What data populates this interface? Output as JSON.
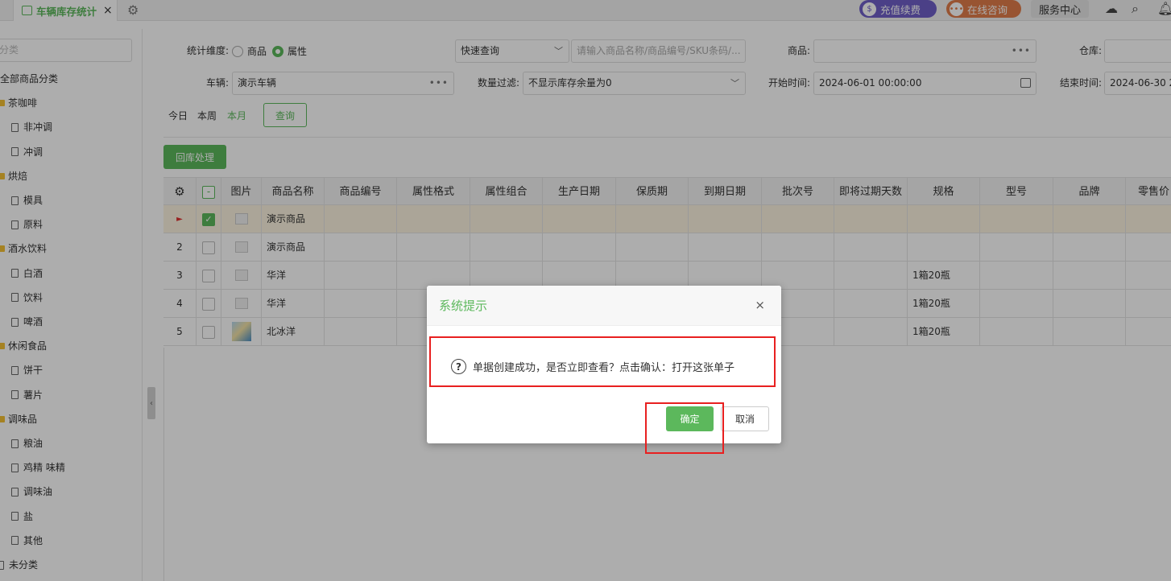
{
  "tabs": {
    "active_label": "车辆库存统计",
    "close_label": "×"
  },
  "header": {
    "recharge": "充值续费",
    "consult": "在线咨询",
    "service": "服务中心"
  },
  "sidebar": {
    "search_placeholder": "分类",
    "items": [
      {
        "label": "全部商品分类",
        "kind": "root"
      },
      {
        "label": "茶咖啡",
        "kind": "folder"
      },
      {
        "label": "非冲调",
        "kind": "file"
      },
      {
        "label": "冲调",
        "kind": "file"
      },
      {
        "label": "烘焙",
        "kind": "folder"
      },
      {
        "label": "模具",
        "kind": "file"
      },
      {
        "label": "原料",
        "kind": "file"
      },
      {
        "label": "酒水饮料",
        "kind": "folder"
      },
      {
        "label": "白酒",
        "kind": "file"
      },
      {
        "label": "饮料",
        "kind": "file"
      },
      {
        "label": "啤酒",
        "kind": "file"
      },
      {
        "label": "休闲食品",
        "kind": "folder"
      },
      {
        "label": "饼干",
        "kind": "file"
      },
      {
        "label": "薯片",
        "kind": "file"
      },
      {
        "label": "调味品",
        "kind": "folder"
      },
      {
        "label": "粮油",
        "kind": "file"
      },
      {
        "label": "鸡精 味精",
        "kind": "file"
      },
      {
        "label": "调味油",
        "kind": "file"
      },
      {
        "label": "盐",
        "kind": "file"
      },
      {
        "label": "其他",
        "kind": "file"
      },
      {
        "label": "未分类",
        "kind": "root-file"
      }
    ]
  },
  "filters": {
    "dimension_label": "统计维度:",
    "dim_goods": "商品",
    "dim_attr": "属性",
    "quick_query": "快速查询",
    "keyword_placeholder": "请输入商品名称/商品编号/SKU条码/...",
    "goods_label": "商品:",
    "warehouse_label": "仓库:",
    "vehicle_label": "车辆:",
    "vehicle_value": "演示车辆",
    "qty_filter_label": "数量过滤:",
    "qty_filter_value": "不显示库存余量为0",
    "start_label": "开始时间:",
    "start_value": "2024-06-01 00:00:00",
    "end_label": "结束时间:",
    "end_value": "2024-06-30 2",
    "today": "今日",
    "this_week": "本周",
    "this_month": "本月",
    "query_btn": "查询",
    "return_btn": "回库处理"
  },
  "table": {
    "columns": [
      "图片",
      "商品名称",
      "商品编号",
      "属性格式",
      "属性组合",
      "生产日期",
      "保质期",
      "到期日期",
      "批次号",
      "即将过期天数",
      "规格",
      "型号",
      "品牌",
      "零售价"
    ],
    "rows": [
      {
        "index": "►",
        "checked": true,
        "name": "演示商品",
        "spec": ""
      },
      {
        "index": "2",
        "checked": false,
        "name": "演示商品",
        "spec": ""
      },
      {
        "index": "3",
        "checked": false,
        "name": "华洋",
        "spec": "1箱20瓶"
      },
      {
        "index": "4",
        "checked": false,
        "name": "华洋",
        "spec": "1箱20瓶"
      },
      {
        "index": "5",
        "checked": false,
        "name": "北冰洋",
        "spec": "1箱20瓶"
      }
    ]
  },
  "dialog": {
    "title": "系统提示",
    "close": "×",
    "message": "单据创建成功，是否立即查看？点击确认：打开这张单子",
    "ok": "确定",
    "cancel": "取消"
  },
  "colors": {
    "accent": "#5cb85c",
    "highlight": "#e82020",
    "recharge": "#6f5fc8",
    "consult": "#e07c4a"
  }
}
